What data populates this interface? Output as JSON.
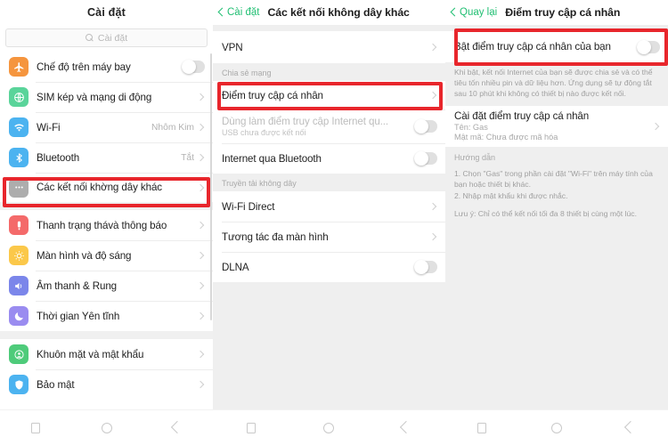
{
  "colors": {
    "highlight": "#e8262c",
    "accent_green": "#21bf73",
    "bg": "#efefef",
    "card": "#ffffff"
  },
  "panel1": {
    "header": {
      "title": "Cài đặt"
    },
    "search": {
      "placeholder": "Cài đặt",
      "icon": "search-icon"
    },
    "groups": [
      {
        "rows": [
          {
            "label": "Chế độ trên máy bay",
            "icon": "airplane-icon",
            "icon_color": "#f5953e",
            "control": "toggle",
            "toggle_on": false
          },
          {
            "label": "SIM kép và mạng di động",
            "icon": "globe-icon",
            "icon_color": "#5ad49a",
            "control": "chevron"
          },
          {
            "label": "Wi-Fi",
            "icon": "wifi-icon",
            "icon_color": "#4cb3f0",
            "control": "chevron",
            "value": "Nhôm Kim"
          },
          {
            "label": "Bluetooth",
            "icon": "bluetooth-icon",
            "icon_color": "#4cb3f0",
            "control": "chevron",
            "value": "Tắt"
          },
          {
            "label": "Các kết nối khờng dây khác",
            "icon": "more-dots-icon",
            "icon_color": "#adadad",
            "control": "chevron",
            "highlighted": true
          }
        ]
      },
      {
        "rows": [
          {
            "label": "Thanh trạng thávà thông báo",
            "icon": "status-bar-icon",
            "icon_color": "#f46a6a",
            "control": "chevron"
          },
          {
            "label": "Màn hình và độ sáng",
            "icon": "brightness-icon",
            "icon_color": "#fbc84a",
            "control": "chevron"
          },
          {
            "label": "Âm thanh & Rung",
            "icon": "sound-icon",
            "icon_color": "#7b86ea",
            "control": "chevron"
          },
          {
            "label": "Thời gian Yên tĩnh",
            "icon": "moon-icon",
            "icon_color": "#9a8cf0",
            "control": "chevron"
          }
        ]
      },
      {
        "rows": [
          {
            "label": "Khuôn mặt và mật khẩu",
            "icon": "face-id-icon",
            "icon_color": "#4ecb7a",
            "control": "chevron"
          },
          {
            "label": "Bảo mật",
            "icon": "shield-icon",
            "icon_color": "#4cb3f0",
            "control": "chevron"
          }
        ]
      }
    ]
  },
  "panel2": {
    "header": {
      "back_label": "Cài đặt",
      "title": "Các kết nối không dây khác"
    },
    "group1": [
      {
        "label": "VPN",
        "control": "chevron"
      }
    ],
    "section1": "Chia sẻ mạng",
    "group2": [
      {
        "label": "Điểm truy cập cá nhân",
        "control": "chevron",
        "highlighted": true
      },
      {
        "label": "Dùng làm điểm truy cập Internet qu...",
        "sub": "USB chưa được kết nối",
        "control": "toggle",
        "toggle_on": false,
        "dimmed": true
      },
      {
        "label": "Internet qua Bluetooth",
        "control": "toggle",
        "toggle_on": false
      }
    ],
    "section2": "Truyền tải không dây",
    "group3": [
      {
        "label": "Wi-Fi Direct",
        "control": "chevron"
      },
      {
        "label": "Tương tác đa màn hình",
        "control": "chevron"
      },
      {
        "label": "DLNA",
        "control": "toggle",
        "toggle_on": false
      }
    ]
  },
  "panel3": {
    "header": {
      "back_label": "Quay lại",
      "title": "Điểm truy cập cá nhân"
    },
    "toggle_row": {
      "label": "Bật điểm truy cập cá nhân của bạn",
      "control": "toggle",
      "toggle_on": false,
      "highlighted": true
    },
    "description": "Khi bật, kết nối Internet của bạn sẽ được chia sẻ và có thể tiêu tốn nhiều pin và dữ liệu hơn. Ứng dụng sẽ tự động tắt sau 10 phút khi không có thiết bị nào được kết nối.",
    "settings_row": {
      "label": "Cài đặt điểm truy cập cá nhân",
      "sub1": "Tên: Gas",
      "sub2": "Mật mã: Chưa được mã hóa",
      "control": "chevron"
    },
    "guide": {
      "heading": "Hướng dẫn",
      "line1": "1. Chọn \"Gas\" trong phần cài đặt \"Wi-Fi\" trên máy tính của bạn hoặc thiết bị khác.",
      "line2": "2. Nhập mật khẩu khi được nhắc.",
      "note": "Lưu ý: Chỉ có thể kết nối tối đa 8 thiết bị cùng một lúc."
    }
  },
  "navbar": {
    "buttons": [
      {
        "name": "recents-button",
        "icon": "square-icon"
      },
      {
        "name": "home-button",
        "icon": "circle-icon"
      },
      {
        "name": "back-button",
        "icon": "triangle-back-icon"
      }
    ]
  }
}
